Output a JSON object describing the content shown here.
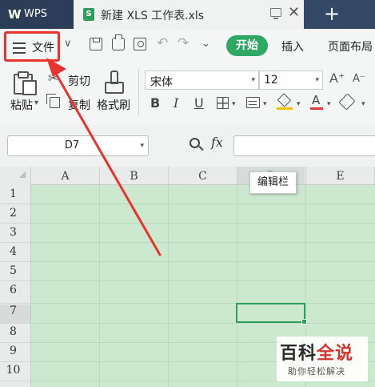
{
  "titlebar": {
    "app_name": "WPS",
    "app_logo": "W",
    "document_tab": "新建 XLS 工作表.xls",
    "file_type_icon": "S",
    "close_glyph": "✕",
    "new_tab_glyph": "+"
  },
  "menu": {
    "file_label": "文件",
    "file_dropdown": "∨",
    "quick_dropdown": "⌄",
    "undo_glyph": "↶",
    "redo_glyph": "↷",
    "tabs": {
      "start": "开始",
      "insert": "插入",
      "page_layout": "页面布局"
    }
  },
  "ribbon": {
    "paste_label": "粘贴",
    "cut_label": "剪切",
    "copy_label": "复制",
    "format_painter_label": "格式刷",
    "dropdown_glyph": "▾",
    "font_name": "宋体",
    "font_size": "12",
    "grow_font": "A⁺",
    "shrink_font": "A⁻",
    "bold": "B",
    "italic": "I",
    "underline": "U",
    "font_color_glyph": "A",
    "cut_glyph": "✂",
    "fill_color": "#f2c200",
    "font_color": "#e53a3a"
  },
  "formula_bar": {
    "cell_reference": "D7",
    "fx_label": "fx",
    "formula_value": ""
  },
  "sheet": {
    "columns": [
      "A",
      "B",
      "C",
      "D",
      "E"
    ],
    "rows": [
      "1",
      "2",
      "3",
      "4",
      "5",
      "6",
      "7",
      "8",
      "9",
      "10"
    ],
    "active_cell": "D7",
    "background_color": "#cce8cf"
  },
  "tooltip": {
    "text": "编辑栏"
  },
  "annotation": {
    "color": "#e8332e"
  },
  "watermark": {
    "title_part1": "百科",
    "title_part2": "全说",
    "subtitle": "助你轻松解决"
  },
  "colors": {
    "titlebar": "#344966",
    "accent_green": "#2fa864",
    "active_cell_border": "#2f9d5c"
  }
}
